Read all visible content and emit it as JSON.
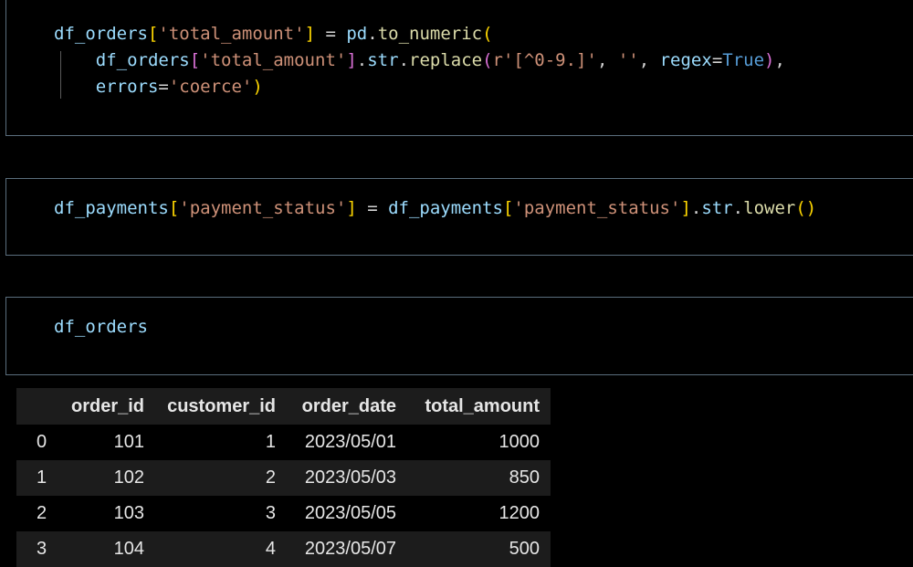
{
  "cells": [
    {
      "id": "cell-1",
      "lines": [
        [
          {
            "t": "df_orders",
            "c": "var"
          },
          {
            "t": "[",
            "c": "p1"
          },
          {
            "t": "'total_amount'",
            "c": "str"
          },
          {
            "t": "]",
            "c": "p1"
          },
          {
            "t": " = ",
            "c": "op"
          },
          {
            "t": "pd",
            "c": "var"
          },
          {
            "t": ".",
            "c": "op"
          },
          {
            "t": "to_numeric",
            "c": "fn"
          },
          {
            "t": "(",
            "c": "p1"
          }
        ],
        [
          {
            "t": "    ",
            "c": "op"
          },
          {
            "t": "df_orders",
            "c": "var"
          },
          {
            "t": "[",
            "c": "p2"
          },
          {
            "t": "'total_amount'",
            "c": "str"
          },
          {
            "t": "]",
            "c": "p2"
          },
          {
            "t": ".",
            "c": "op"
          },
          {
            "t": "str",
            "c": "var"
          },
          {
            "t": ".",
            "c": "op"
          },
          {
            "t": "replace",
            "c": "fn"
          },
          {
            "t": "(",
            "c": "p2"
          },
          {
            "t": "r'[^0-9.]'",
            "c": "str"
          },
          {
            "t": ", ",
            "c": "op"
          },
          {
            "t": "''",
            "c": "str"
          },
          {
            "t": ", ",
            "c": "op"
          },
          {
            "t": "regex",
            "c": "var"
          },
          {
            "t": "=",
            "c": "op"
          },
          {
            "t": "True",
            "c": "kw"
          },
          {
            "t": ")",
            "c": "p2"
          },
          {
            "t": ",",
            "c": "op"
          }
        ],
        [
          {
            "t": "    ",
            "c": "op"
          },
          {
            "t": "errors",
            "c": "var"
          },
          {
            "t": "=",
            "c": "op"
          },
          {
            "t": "'coerce'",
            "c": "str"
          },
          {
            "t": ")",
            "c": "p1"
          }
        ]
      ]
    },
    {
      "id": "cell-2",
      "lines": [
        [
          {
            "t": "df_payments",
            "c": "var"
          },
          {
            "t": "[",
            "c": "p1"
          },
          {
            "t": "'payment_status'",
            "c": "str"
          },
          {
            "t": "]",
            "c": "p1"
          },
          {
            "t": " = ",
            "c": "op"
          },
          {
            "t": "df_payments",
            "c": "var"
          },
          {
            "t": "[",
            "c": "p1"
          },
          {
            "t": "'payment_status'",
            "c": "str"
          },
          {
            "t": "]",
            "c": "p1"
          },
          {
            "t": ".",
            "c": "op"
          },
          {
            "t": "str",
            "c": "var"
          },
          {
            "t": ".",
            "c": "op"
          },
          {
            "t": "lower",
            "c": "fn"
          },
          {
            "t": "()",
            "c": "p1"
          }
        ]
      ]
    },
    {
      "id": "cell-3",
      "lines": [
        [
          {
            "t": "df_orders",
            "c": "var"
          }
        ]
      ]
    }
  ],
  "output_table": {
    "index_header": "",
    "columns": [
      "order_id",
      "customer_id",
      "order_date",
      "total_amount"
    ],
    "rows": [
      {
        "index": "0",
        "values": [
          "101",
          "1",
          "2023/05/01",
          "1000"
        ]
      },
      {
        "index": "1",
        "values": [
          "102",
          "2",
          "2023/05/03",
          "850"
        ]
      },
      {
        "index": "2",
        "values": [
          "103",
          "3",
          "2023/05/05",
          "1200"
        ]
      },
      {
        "index": "3",
        "values": [
          "104",
          "4",
          "2023/05/07",
          "500"
        ]
      }
    ]
  }
}
